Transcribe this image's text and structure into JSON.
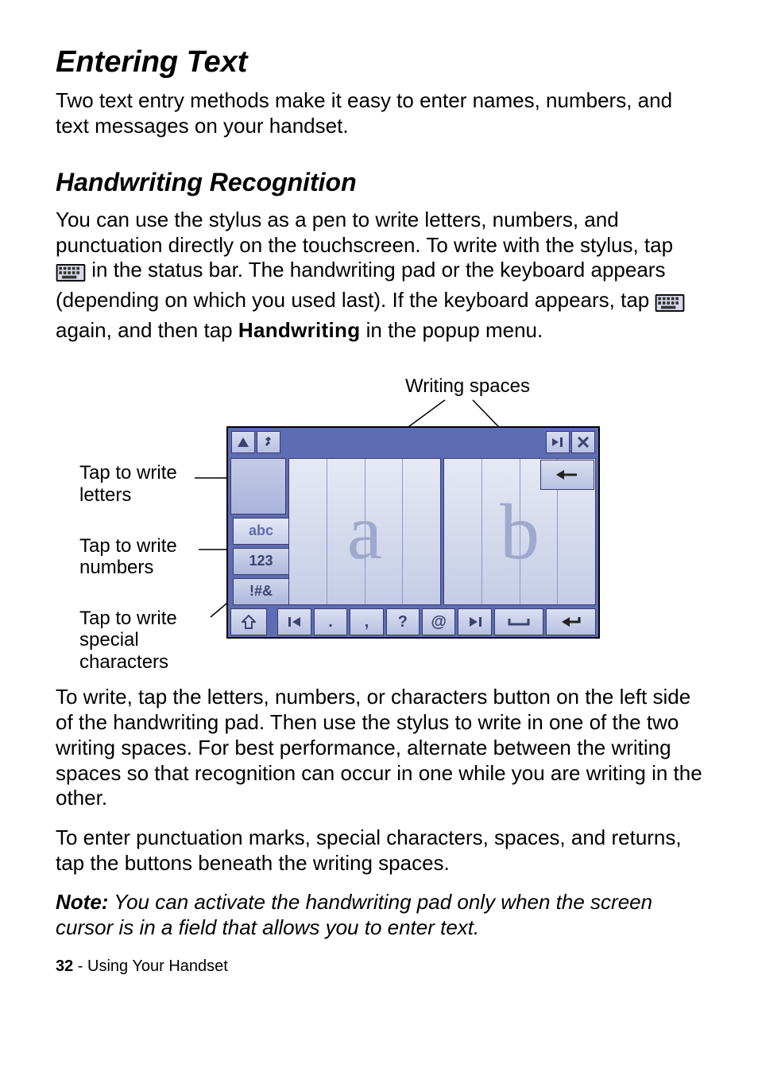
{
  "h1": "Entering Text",
  "p_intro": "Two text entry methods make it easy to enter names, numbers, and text messages on your handset.",
  "h2": "Handwriting Recognition",
  "p_hw_1a": "You can use the stylus as a pen to write letters, numbers, and punctuation directly on the touchscreen. To write with the stylus, tap ",
  "p_hw_1b": " in the status bar. The handwriting pad or the keyboard appears (depending on which you used last). If the keyboard appears, tap ",
  "p_hw_1c": " again, and then tap ",
  "popup_label": "Handwriting",
  "p_hw_1d": " in the popup menu.",
  "diagram": {
    "writing_spaces_label": "Writing spaces",
    "callout_letters": "Tap to write letters",
    "callout_numbers": "Tap to write numbers",
    "callout_special": "Tap to write special characters",
    "tab_abc": "abc",
    "tab_123": "123",
    "tab_sym": "!#&",
    "box1_char": "a",
    "box2_char": "b",
    "bottom_row": {
      "shift": "⇧",
      "prev": "◄◄",
      "period": ".",
      "comma": ",",
      "question": "?",
      "at": "@",
      "next": "►►"
    }
  },
  "p_write_1": "To write, tap the letters, numbers, or characters button on the left side of the handwriting pad. Then use the stylus to write in one of the two writing spaces. For best performance, alternate between the writing spaces so that recognition can occur in one while you are writing in the other.",
  "p_write_2": "To enter punctuation marks, special characters, spaces, and returns, tap the buttons beneath the writing spaces.",
  "note_label": "Note:",
  "note_body": " You can activate the handwriting pad only when the screen cursor is in a field that allows you to enter text.",
  "footer_page": "32",
  "footer_sep": " - ",
  "footer_section": "Using Your Handset"
}
